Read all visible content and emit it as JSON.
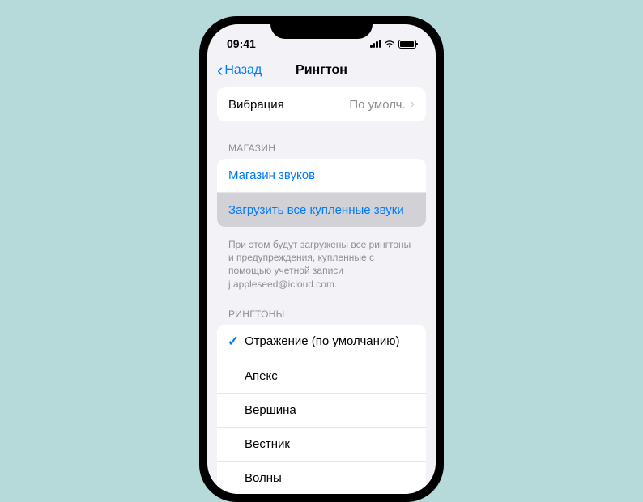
{
  "status": {
    "time": "09:41"
  },
  "nav": {
    "back": "Назад",
    "title": "Рингтон"
  },
  "vibration": {
    "label": "Вибрация",
    "value": "По умолч."
  },
  "store": {
    "header": "МАГАЗИН",
    "tone_store": "Магазин звуков",
    "download_all": "Загрузить все купленные звуки",
    "footer": "При этом будут загружены все рингтоны и предупреждения, купленные с помощью учетной записи j.appleseed@icloud.com."
  },
  "ringtones": {
    "header": "РИНГТОНЫ",
    "items": [
      {
        "label": "Отражение (по умолчанию)",
        "selected": true
      },
      {
        "label": "Апекс",
        "selected": false
      },
      {
        "label": "Вершина",
        "selected": false
      },
      {
        "label": "Вестник",
        "selected": false
      },
      {
        "label": "Волны",
        "selected": false
      }
    ]
  }
}
